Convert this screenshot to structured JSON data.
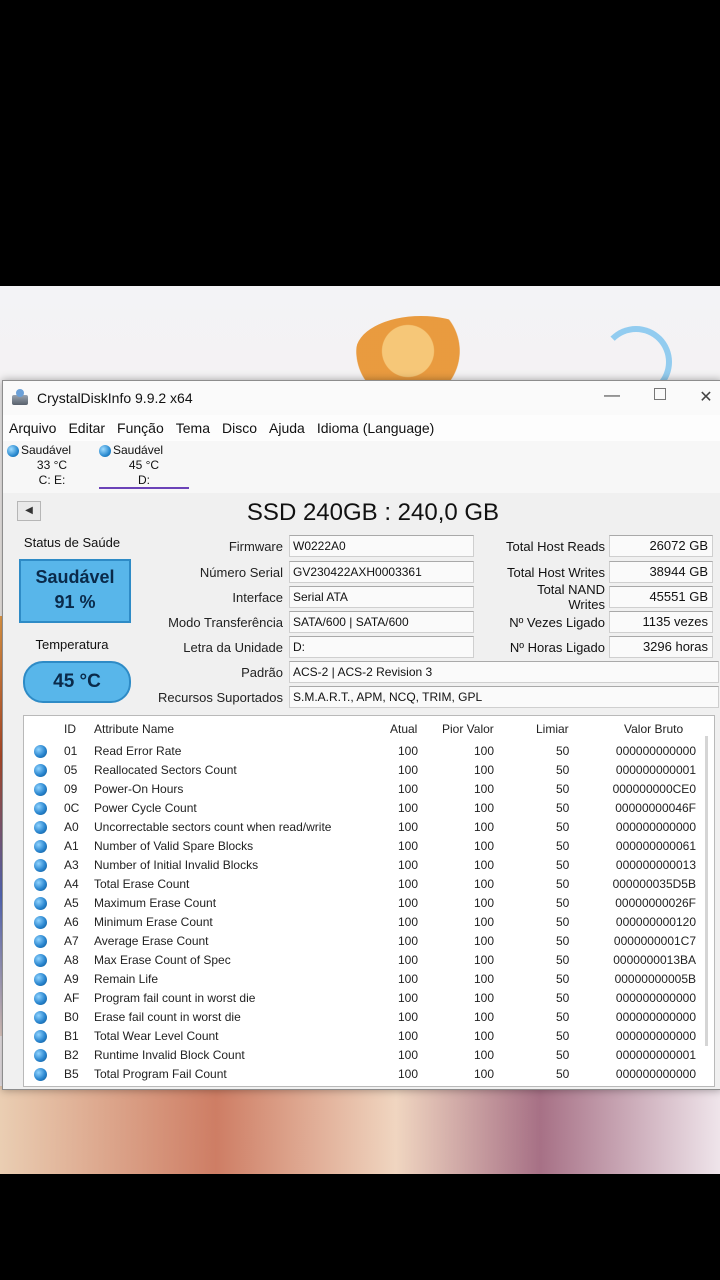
{
  "window": {
    "title": "CrystalDiskInfo 9.9.2 x64"
  },
  "menu": [
    "Arquivo",
    "Editar",
    "Função",
    "Tema",
    "Disco",
    "Ajuda",
    "Idioma (Language)"
  ],
  "drives": [
    {
      "status": "Saudável",
      "temp": "33 °C",
      "letters": "C: E:"
    },
    {
      "status": "Saudável",
      "temp": "45 °C",
      "letters": "D:"
    }
  ],
  "disk": {
    "title": "SSD 240GB : 240,0 GB",
    "health_label": "Status de Saúde",
    "health_status": "Saudável",
    "health_percent": "91 %",
    "temp_label": "Temperatura",
    "temp": "45 °C",
    "info": [
      {
        "label": "Firmware",
        "value": "W0222A0"
      },
      {
        "label": "Número Serial",
        "value": "GV230422AXH0003361"
      },
      {
        "label": "Interface",
        "value": "Serial ATA"
      },
      {
        "label": "Modo Transferência",
        "value": "SATA/600 | SATA/600"
      },
      {
        "label": "Letra da Unidade",
        "value": "D:"
      },
      {
        "label": "Padrão",
        "value": "ACS-2 | ACS-2 Revision 3"
      },
      {
        "label": "Recursos Suportados",
        "value": "S.M.A.R.T., APM, NCQ, TRIM, GPL"
      }
    ],
    "stats": [
      {
        "label": "Total Host Reads",
        "value": "26072 GB"
      },
      {
        "label": "Total Host Writes",
        "value": "38944 GB"
      },
      {
        "label": "Total NAND Writes",
        "value": "45551 GB"
      },
      {
        "label": "Nº Vezes Ligado",
        "value": "1135 vezes"
      },
      {
        "label": "Nº Horas Ligado",
        "value": "3296 horas"
      }
    ]
  },
  "smart": {
    "headers": {
      "id": "ID",
      "name": "Attribute Name",
      "current": "Atual",
      "worst": "Pior Valor",
      "threshold": "Limiar",
      "raw": "Valor Bruto"
    },
    "rows": [
      {
        "id": "01",
        "name": "Read Error Rate",
        "current": "100",
        "worst": "100",
        "threshold": "50",
        "raw": "000000000000"
      },
      {
        "id": "05",
        "name": "Reallocated Sectors Count",
        "current": "100",
        "worst": "100",
        "threshold": "50",
        "raw": "000000000001"
      },
      {
        "id": "09",
        "name": "Power-On Hours",
        "current": "100",
        "worst": "100",
        "threshold": "50",
        "raw": "000000000CE0"
      },
      {
        "id": "0C",
        "name": "Power Cycle Count",
        "current": "100",
        "worst": "100",
        "threshold": "50",
        "raw": "00000000046F"
      },
      {
        "id": "A0",
        "name": "Uncorrectable sectors count when read/write",
        "current": "100",
        "worst": "100",
        "threshold": "50",
        "raw": "000000000000"
      },
      {
        "id": "A1",
        "name": "Number of Valid Spare Blocks",
        "current": "100",
        "worst": "100",
        "threshold": "50",
        "raw": "000000000061"
      },
      {
        "id": "A3",
        "name": "Number of Initial Invalid Blocks",
        "current": "100",
        "worst": "100",
        "threshold": "50",
        "raw": "000000000013"
      },
      {
        "id": "A4",
        "name": "Total Erase Count",
        "current": "100",
        "worst": "100",
        "threshold": "50",
        "raw": "000000035D5B"
      },
      {
        "id": "A5",
        "name": "Maximum Erase Count",
        "current": "100",
        "worst": "100",
        "threshold": "50",
        "raw": "00000000026F"
      },
      {
        "id": "A6",
        "name": "Minimum Erase Count",
        "current": "100",
        "worst": "100",
        "threshold": "50",
        "raw": "000000000120"
      },
      {
        "id": "A7",
        "name": "Average Erase Count",
        "current": "100",
        "worst": "100",
        "threshold": "50",
        "raw": "0000000001C7"
      },
      {
        "id": "A8",
        "name": "Max Erase Count of Spec",
        "current": "100",
        "worst": "100",
        "threshold": "50",
        "raw": "0000000013BA"
      },
      {
        "id": "A9",
        "name": "Remain Life",
        "current": "100",
        "worst": "100",
        "threshold": "50",
        "raw": "00000000005B"
      },
      {
        "id": "AF",
        "name": "Program fail count in worst die",
        "current": "100",
        "worst": "100",
        "threshold": "50",
        "raw": "000000000000"
      },
      {
        "id": "B0",
        "name": "Erase fail count in worst die",
        "current": "100",
        "worst": "100",
        "threshold": "50",
        "raw": "000000000000"
      },
      {
        "id": "B1",
        "name": "Total Wear Level Count",
        "current": "100",
        "worst": "100",
        "threshold": "50",
        "raw": "000000000000"
      },
      {
        "id": "B2",
        "name": "Runtime Invalid Block Count",
        "current": "100",
        "worst": "100",
        "threshold": "50",
        "raw": "000000000001"
      },
      {
        "id": "B5",
        "name": "Total Program Fail Count",
        "current": "100",
        "worst": "100",
        "threshold": "50",
        "raw": "000000000000"
      }
    ]
  }
}
